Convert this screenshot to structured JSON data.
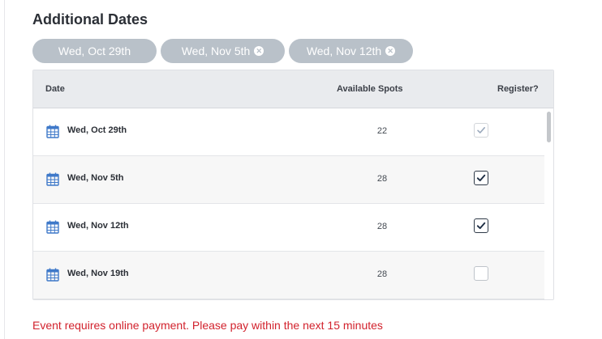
{
  "section": {
    "title": "Additional Dates"
  },
  "chips": [
    {
      "label": "Wed, Oct 29th",
      "removable": false
    },
    {
      "label": "Wed, Nov 5th",
      "removable": true
    },
    {
      "label": "Wed, Nov 12th",
      "removable": true
    }
  ],
  "table": {
    "headers": {
      "date": "Date",
      "spots": "Available Spots",
      "register": "Register?"
    },
    "rows": [
      {
        "date": "Wed, Oct 29th",
        "spots": "22",
        "register": "checked-disabled"
      },
      {
        "date": "Wed, Nov 5th",
        "spots": "28",
        "register": "checked"
      },
      {
        "date": "Wed, Nov 12th",
        "spots": "28",
        "register": "checked"
      },
      {
        "date": "Wed, Nov 19th",
        "spots": "28",
        "register": "unchecked"
      }
    ]
  },
  "message": {
    "error": "Event requires online payment. Please pay within the next 15 minutes"
  },
  "icons": {
    "row_icon": "calendar-icon",
    "chip_remove": "close-circle-icon",
    "check": "checkmark-icon"
  },
  "colors": {
    "chip_bg": "#b9c1c9",
    "calendar_blue": "#3f79c9",
    "error_red": "#d2222d",
    "check_dark": "#1f2f45"
  }
}
